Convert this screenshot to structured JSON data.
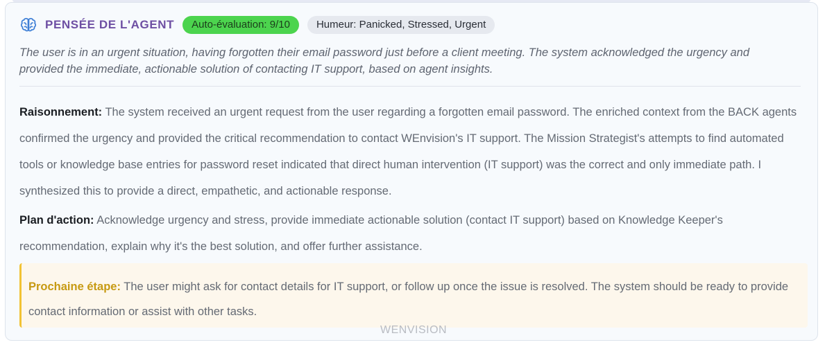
{
  "header": {
    "title": "PENSÉE DE L'AGENT",
    "score_badge": "Auto-évaluation: 9/10",
    "mood_badge": "Humeur: Panicked, Stressed, Urgent",
    "icon": "brain-icon"
  },
  "summary": "The user is in an urgent situation, having forgotten their email password just before a client meeting. The system acknowledged the urgency and provided the immediate, actionable solution of contacting IT support, based on agent insights.",
  "reasoning": {
    "label": "Raisonnement:",
    "text": " The system received an urgent request from the user regarding a forgotten email password. The enriched context from the BACK agents confirmed the urgency and provided the critical recommendation to contact WEnvision's IT support. The Mission Strategist's attempts to find automated tools or knowledge base entries for password reset indicated that direct human intervention (IT support) was the correct and only immediate path. I synthesized this to provide a direct, empathetic, and actionable response."
  },
  "plan": {
    "label": "Plan d'action:",
    "text": " Acknowledge urgency and stress, provide immediate actionable solution (contact IT support) based on Knowledge Keeper's recommendation, explain why it's the best solution, and offer further assistance."
  },
  "next_step": {
    "label": "Prochaine étape:",
    "text": " The user might ask for contact details for IT support, or follow up once the issue is resolved. The system should be ready to provide contact information or assist with other tasks."
  },
  "watermark": "WENVISION",
  "colors": {
    "title": "#6e4fa3",
    "score_badge_bg": "#4cd44e",
    "mood_badge_bg": "#e6e9ef",
    "next_step_accent": "#f2c233",
    "next_step_label": "#c79a12",
    "card_bg": "#f7fafd"
  }
}
